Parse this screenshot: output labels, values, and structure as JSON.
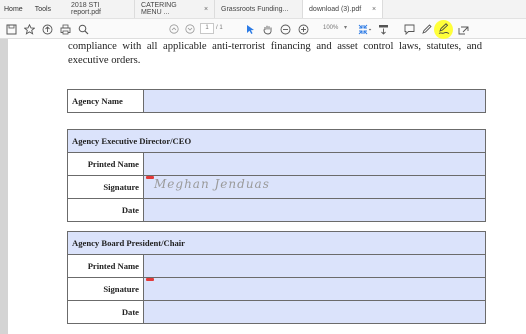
{
  "tabbar": {
    "home": "Home",
    "tools": "Tools",
    "tabs": [
      {
        "label": "2018 STI report.pdf",
        "closable": false
      },
      {
        "label": "CATERING MENU ...",
        "closable": true
      },
      {
        "label": "Grassroots Funding...",
        "closable": false
      },
      {
        "label": "download (3).pdf",
        "closable": true
      }
    ]
  },
  "toolbar": {
    "page_current": "1",
    "page_total": "/ 1",
    "zoom": "100%",
    "icons": [
      "save-icon",
      "bookmark-star-icon",
      "upload-icon",
      "print-icon",
      "search-icon",
      "page-up-icon",
      "page-down-icon",
      "select-arrow-icon",
      "hand-icon",
      "zoom-out-icon",
      "zoom-in-icon",
      "zoom-dropdown",
      "fit-page-icon",
      "comment-icon",
      "pen-icon",
      "fill-sign-icon",
      "share-icon"
    ],
    "highlight_color": "#ffff3a"
  },
  "document": {
    "intro_text": "compliance with all applicable anti-terrorist financing and asset control laws, statutes, and executive orders.",
    "agency_name_label": "Agency Name",
    "section1": {
      "header": "Agency Executive Director/CEO",
      "printed_name_label": "Printed Name",
      "signature_label": "Signature",
      "signature_value": "Meghan Jenduas",
      "date_label": "Date"
    },
    "section2": {
      "header": "Agency Board President/Chair",
      "printed_name_label": "Printed Name",
      "signature_label": "Signature",
      "date_label": "Date"
    },
    "field_color": "#dbe3fb",
    "required_mark_color": "#e23a3a"
  }
}
